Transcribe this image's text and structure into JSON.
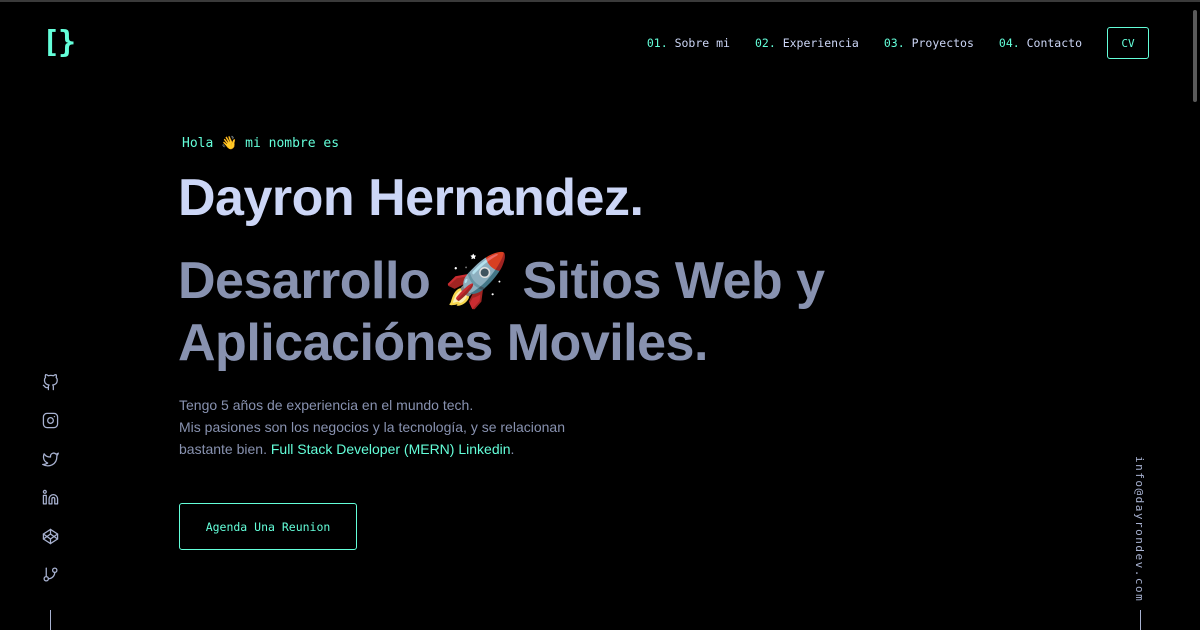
{
  "header": {
    "logo": "[}",
    "nav": [
      {
        "num": "01.",
        "label": "Sobre mi"
      },
      {
        "num": "02.",
        "label": "Experiencia"
      },
      {
        "num": "03.",
        "label": "Proyectos"
      },
      {
        "num": "04.",
        "label": "Contacto"
      }
    ],
    "cv_label": "CV"
  },
  "hero": {
    "greeting": "Hola 👋 mi nombre es",
    "name": "Dayron Hernandez.",
    "tagline": "Desarrollo 🚀 Sitios Web y Aplicaciónes Moviles.",
    "desc_line1": "Tengo 5 años de experiencia en el mundo tech.",
    "desc_line2": "Mis pasiones son los negocios y la tecnología, y se relacionan",
    "desc_line3": "bastante bien.",
    "desc_role": "Full Stack Developer (MERN)",
    "desc_link": "Linkedin",
    "desc_end": ".",
    "cta_label": "Agenda Una Reunion"
  },
  "social": {
    "icons": [
      "github-icon",
      "instagram-icon",
      "twitter-icon",
      "linkedin-icon",
      "codepen-icon",
      "git-branch-icon"
    ]
  },
  "email": "info@dayrondev.com",
  "colors": {
    "background": "#000000",
    "accent": "#64ffda",
    "heading": "#ccd6f6",
    "muted": "#8892b0"
  }
}
